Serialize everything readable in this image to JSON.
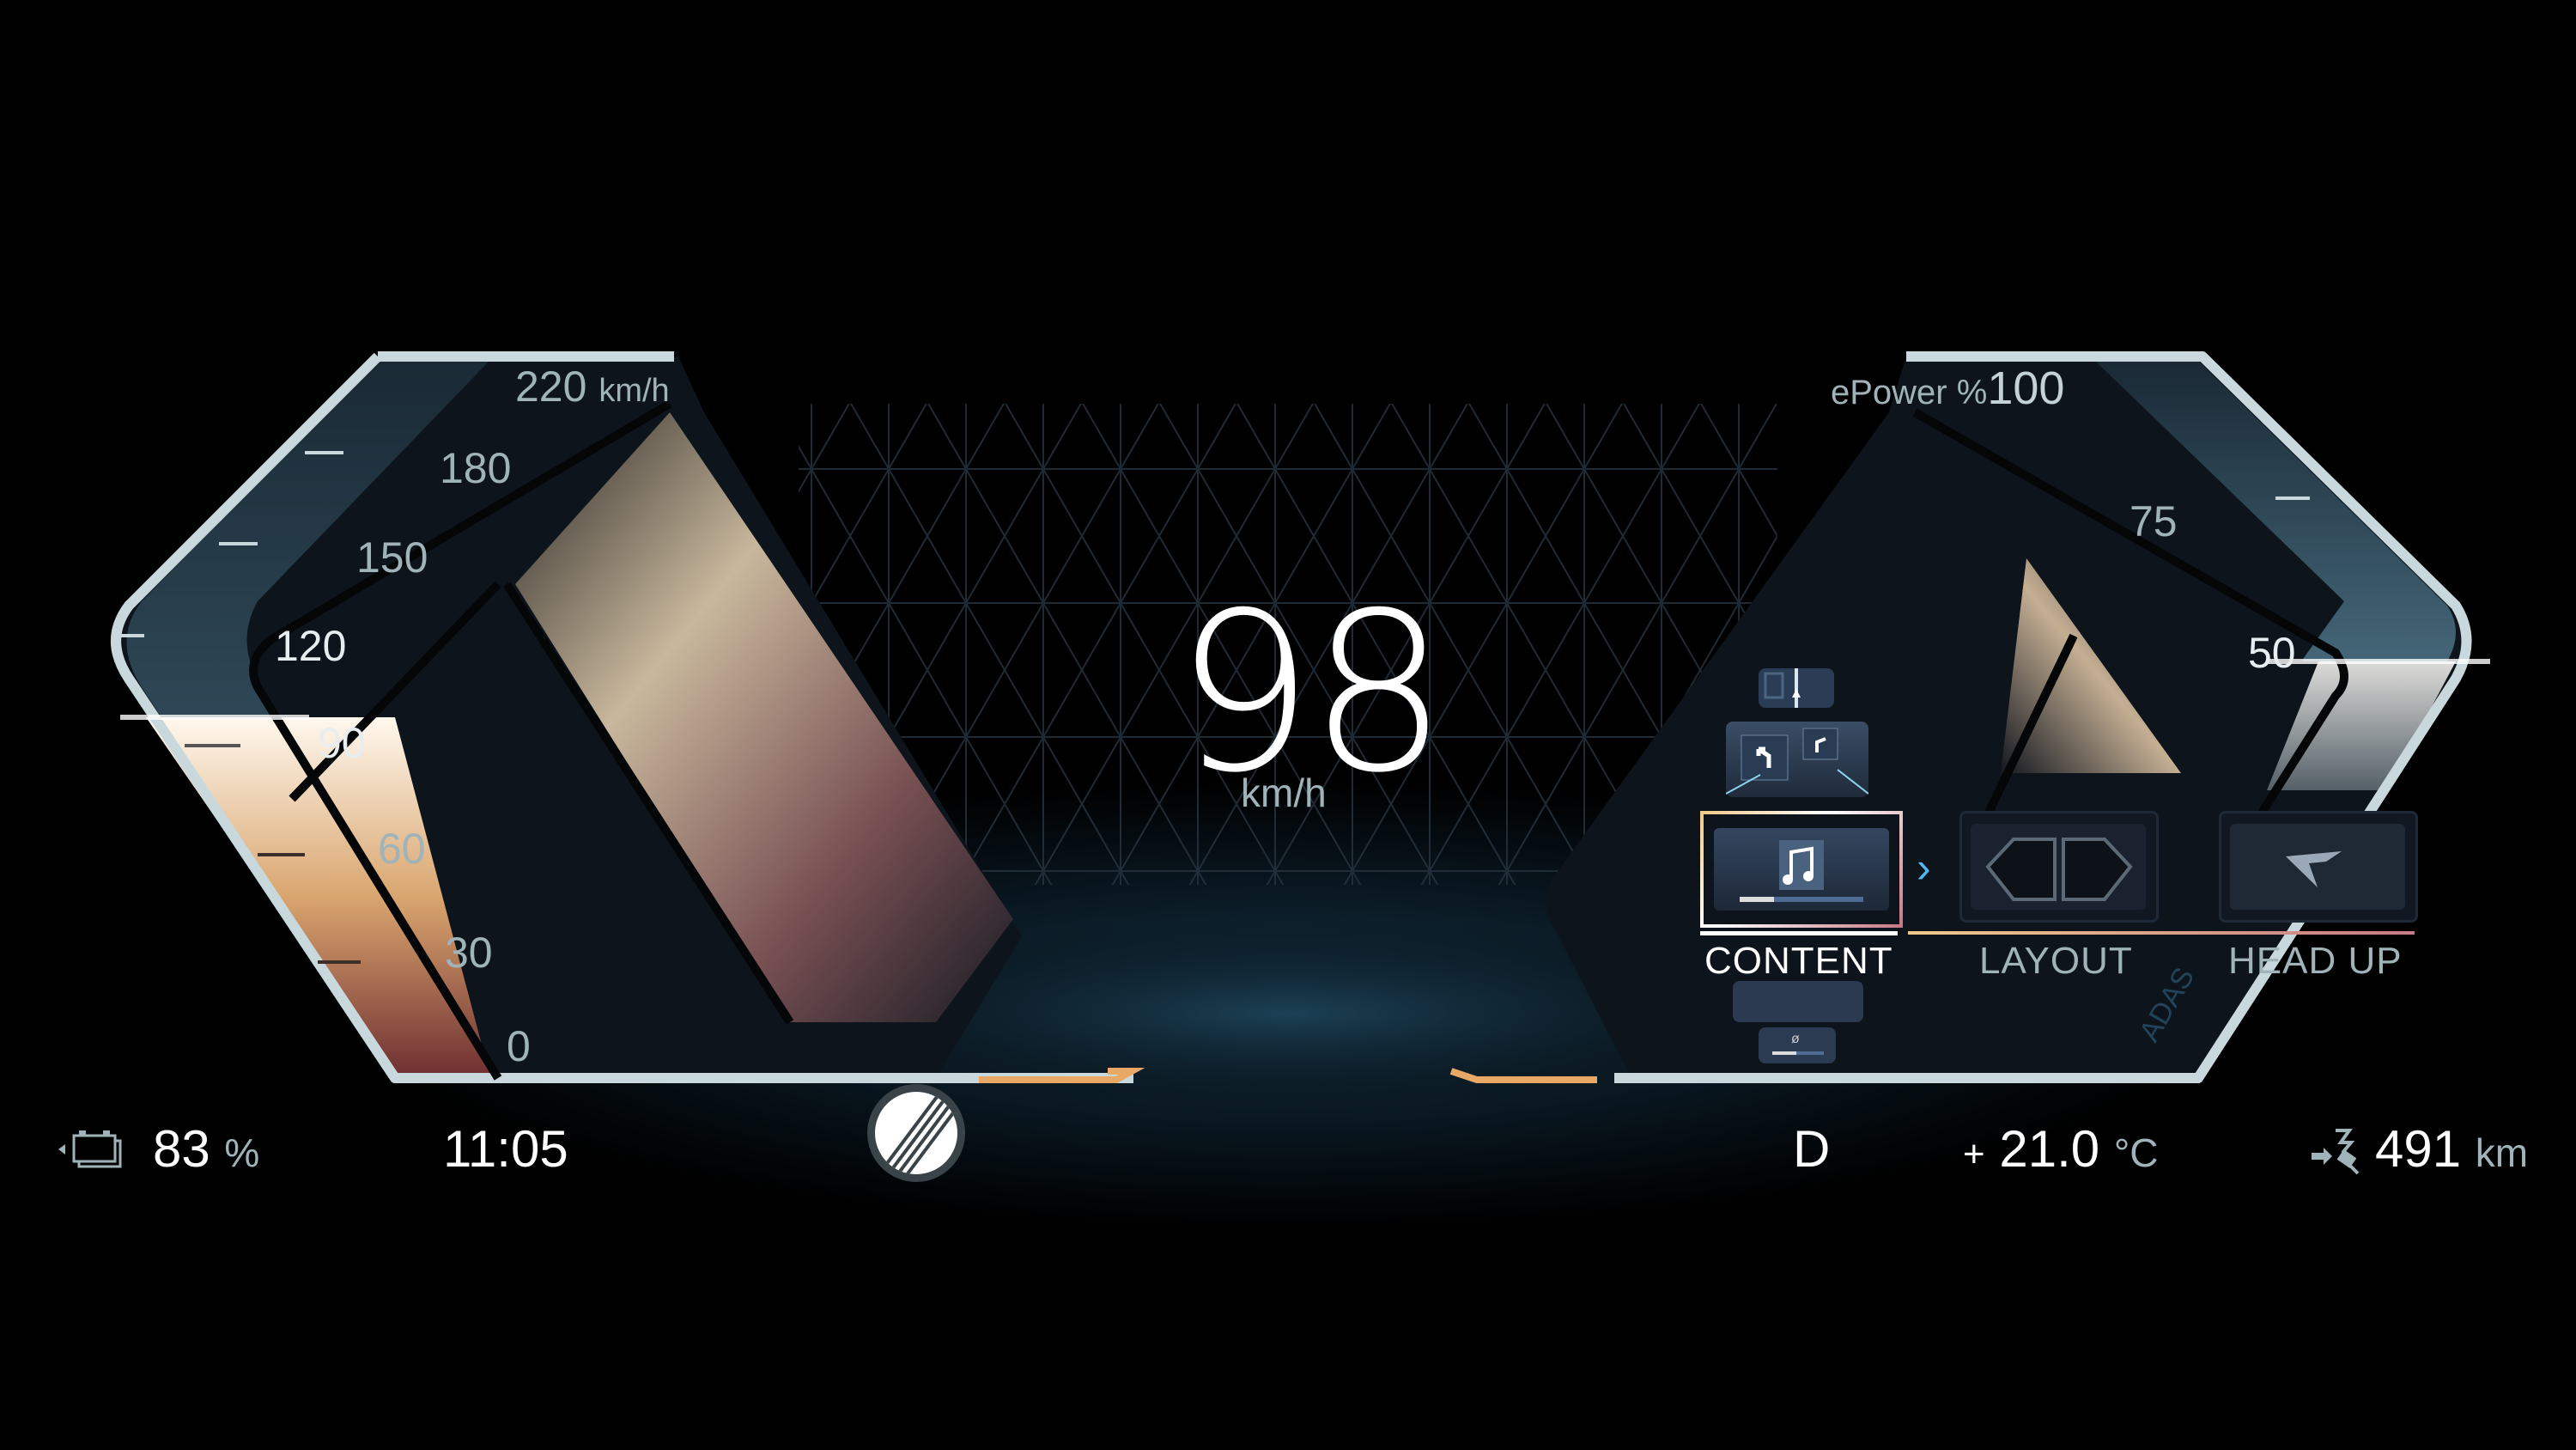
{
  "speedometer": {
    "current_speed": "98",
    "speed_unit": "km/h",
    "max_label": "220",
    "max_unit": "km/h",
    "scale_ticks": [
      "180",
      "150",
      "120",
      "90",
      "60",
      "30",
      "0"
    ],
    "value_fraction": 0.445
  },
  "power_meter": {
    "label": "ePower %",
    "max_label": "100",
    "scale_ticks": [
      "75",
      "50"
    ],
    "value_fraction": 0.5
  },
  "menu": {
    "items": [
      {
        "label": "CONTENT",
        "icon": "music-note-icon",
        "selected": true
      },
      {
        "label": "LAYOUT",
        "icon": "layout-icon",
        "selected": false
      },
      {
        "label": "HEAD UP",
        "icon": "head-up-icon",
        "selected": false
      }
    ],
    "stack_above": [
      "map-thumbnail",
      "navigation-arrows-thumbnail"
    ],
    "stack_below": [
      "pattern-thumbnail",
      "audio-thumbnail"
    ],
    "side_label": "ADAS",
    "active_gradient": [
      "#f2c98a",
      "#c77a86"
    ]
  },
  "status_bar": {
    "battery_percent": "83",
    "battery_unit": "%",
    "time": "11:05",
    "gear": "D",
    "temp_sign": "+",
    "temperature": "21.0",
    "temp_unit": "°C",
    "range": "491",
    "range_unit": "km",
    "speed_limit_sign": "end-of-speed-limit-icon"
  },
  "colors": {
    "accent_orange": "#e8a866",
    "frame": "#c8d8dc",
    "tick_text": "#9fb3b9"
  }
}
